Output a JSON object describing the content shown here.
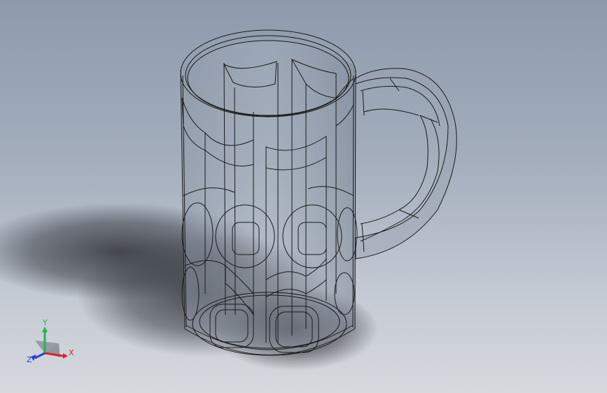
{
  "viewport": {
    "background_top": "#8e9aac",
    "background_bottom": "#d6d9de"
  },
  "model": {
    "edge_color": "#1a1a1a",
    "body_tint": "#9aa4b2",
    "shadow_color": "#3a3e44"
  },
  "triad": {
    "x_label": "X",
    "y_label": "Y",
    "z_label": "Z",
    "x_color": "#d6262b",
    "y_color": "#2bb24a",
    "z_color": "#2a3fd1"
  }
}
